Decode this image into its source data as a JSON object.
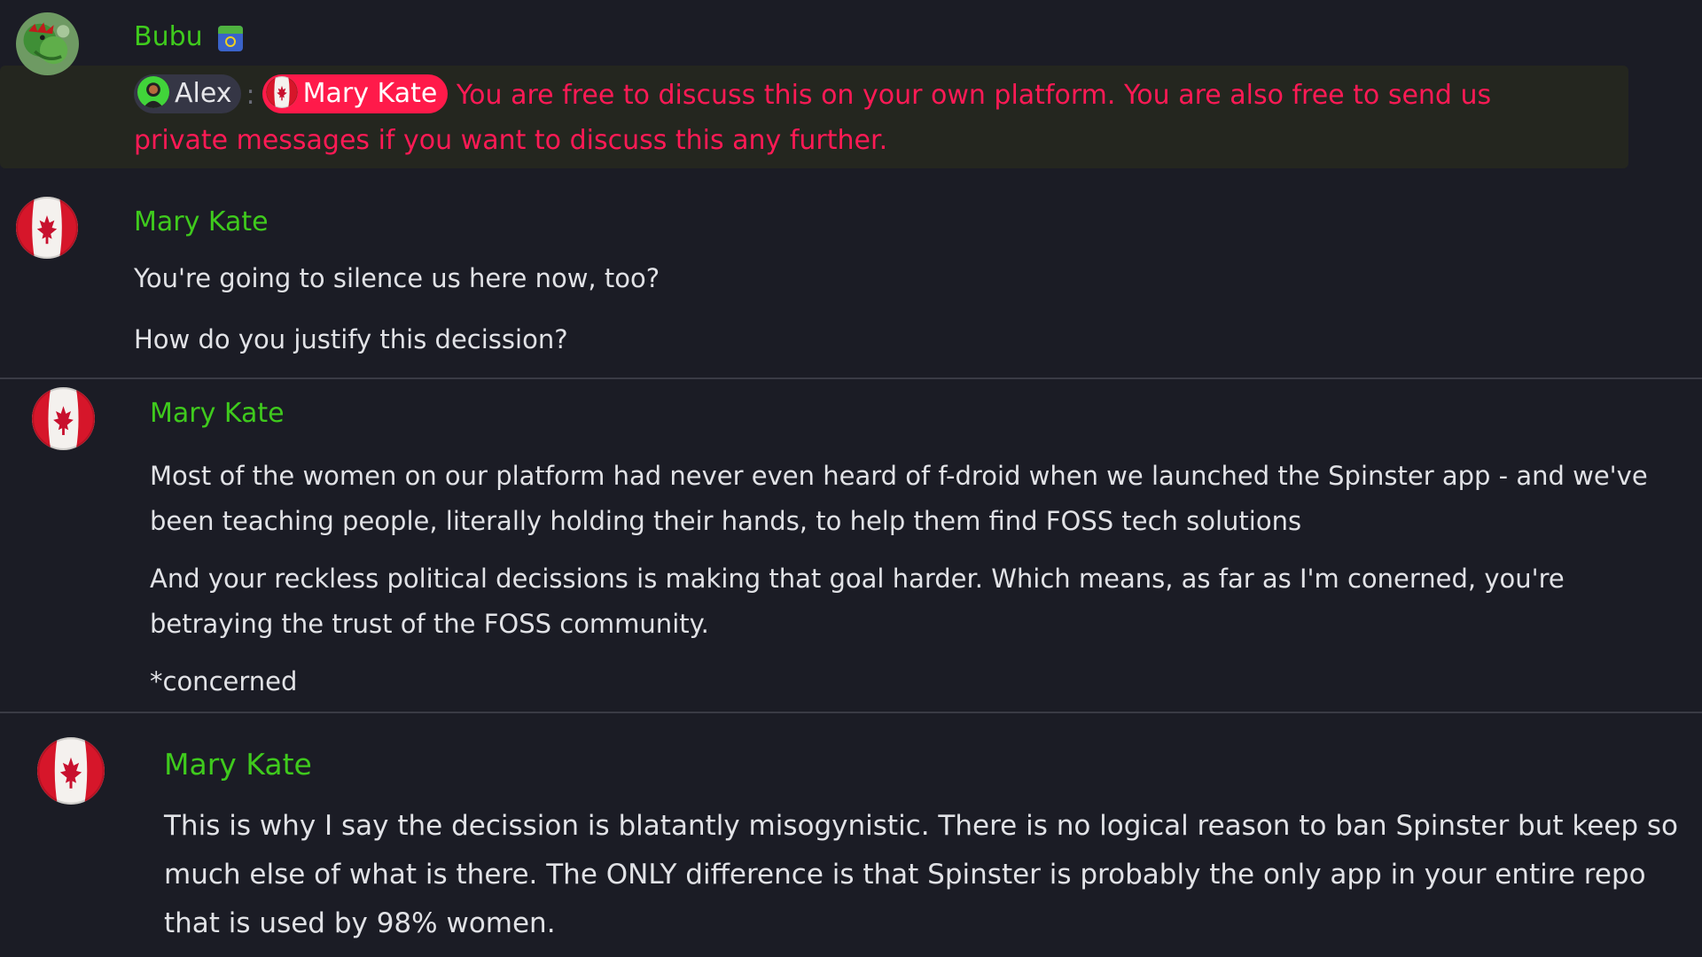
{
  "messages": [
    {
      "sender": "Bubu",
      "badge_icon": "emoji-flag-icon",
      "reply": {
        "mentions": [
          {
            "name": "Alex",
            "icon": "alex-avatar-icon"
          },
          {
            "name": "Mary Kate",
            "icon": "mary-kate-avatar-icon"
          }
        ],
        "separator": ":",
        "text": "You are free to discuss this on your own platform. You are also free to send us private messages if you want to discuss this any further."
      },
      "highlight_color": "#24261f",
      "text_color": "#ff1a55"
    },
    {
      "sender": "Mary Kate",
      "paragraphs": [
        "You're going to silence us here now, too?",
        "How do you justify this decission?"
      ]
    },
    {
      "sender": "Mary Kate",
      "paragraphs": [
        "Most of the women on our platform had never even heard of f-droid when we launched the Spinster app - and we've been teaching people, literally holding their hands, to help them find FOSS tech solutions",
        "And your reckless political decissions is making that goal harder. Which means, as far as I'm conerned, you're betraying the trust of the FOSS community.",
        "*concerned"
      ]
    },
    {
      "sender": "Mary Kate",
      "paragraphs": [
        "This is why I say the decission is blatantly misogynistic. There is no logical reason to ban Spinster but keep so much else of what is there. The ONLY difference is that Spinster is probably the only app in your entire repo that is used by 98% women."
      ]
    }
  ],
  "colors": {
    "background": "#1b1c25",
    "sender_name": "#3fca1d",
    "body_text": "#e1e2e6",
    "divider": "#3a3b45",
    "mention_pill": "#ff1a4a"
  }
}
